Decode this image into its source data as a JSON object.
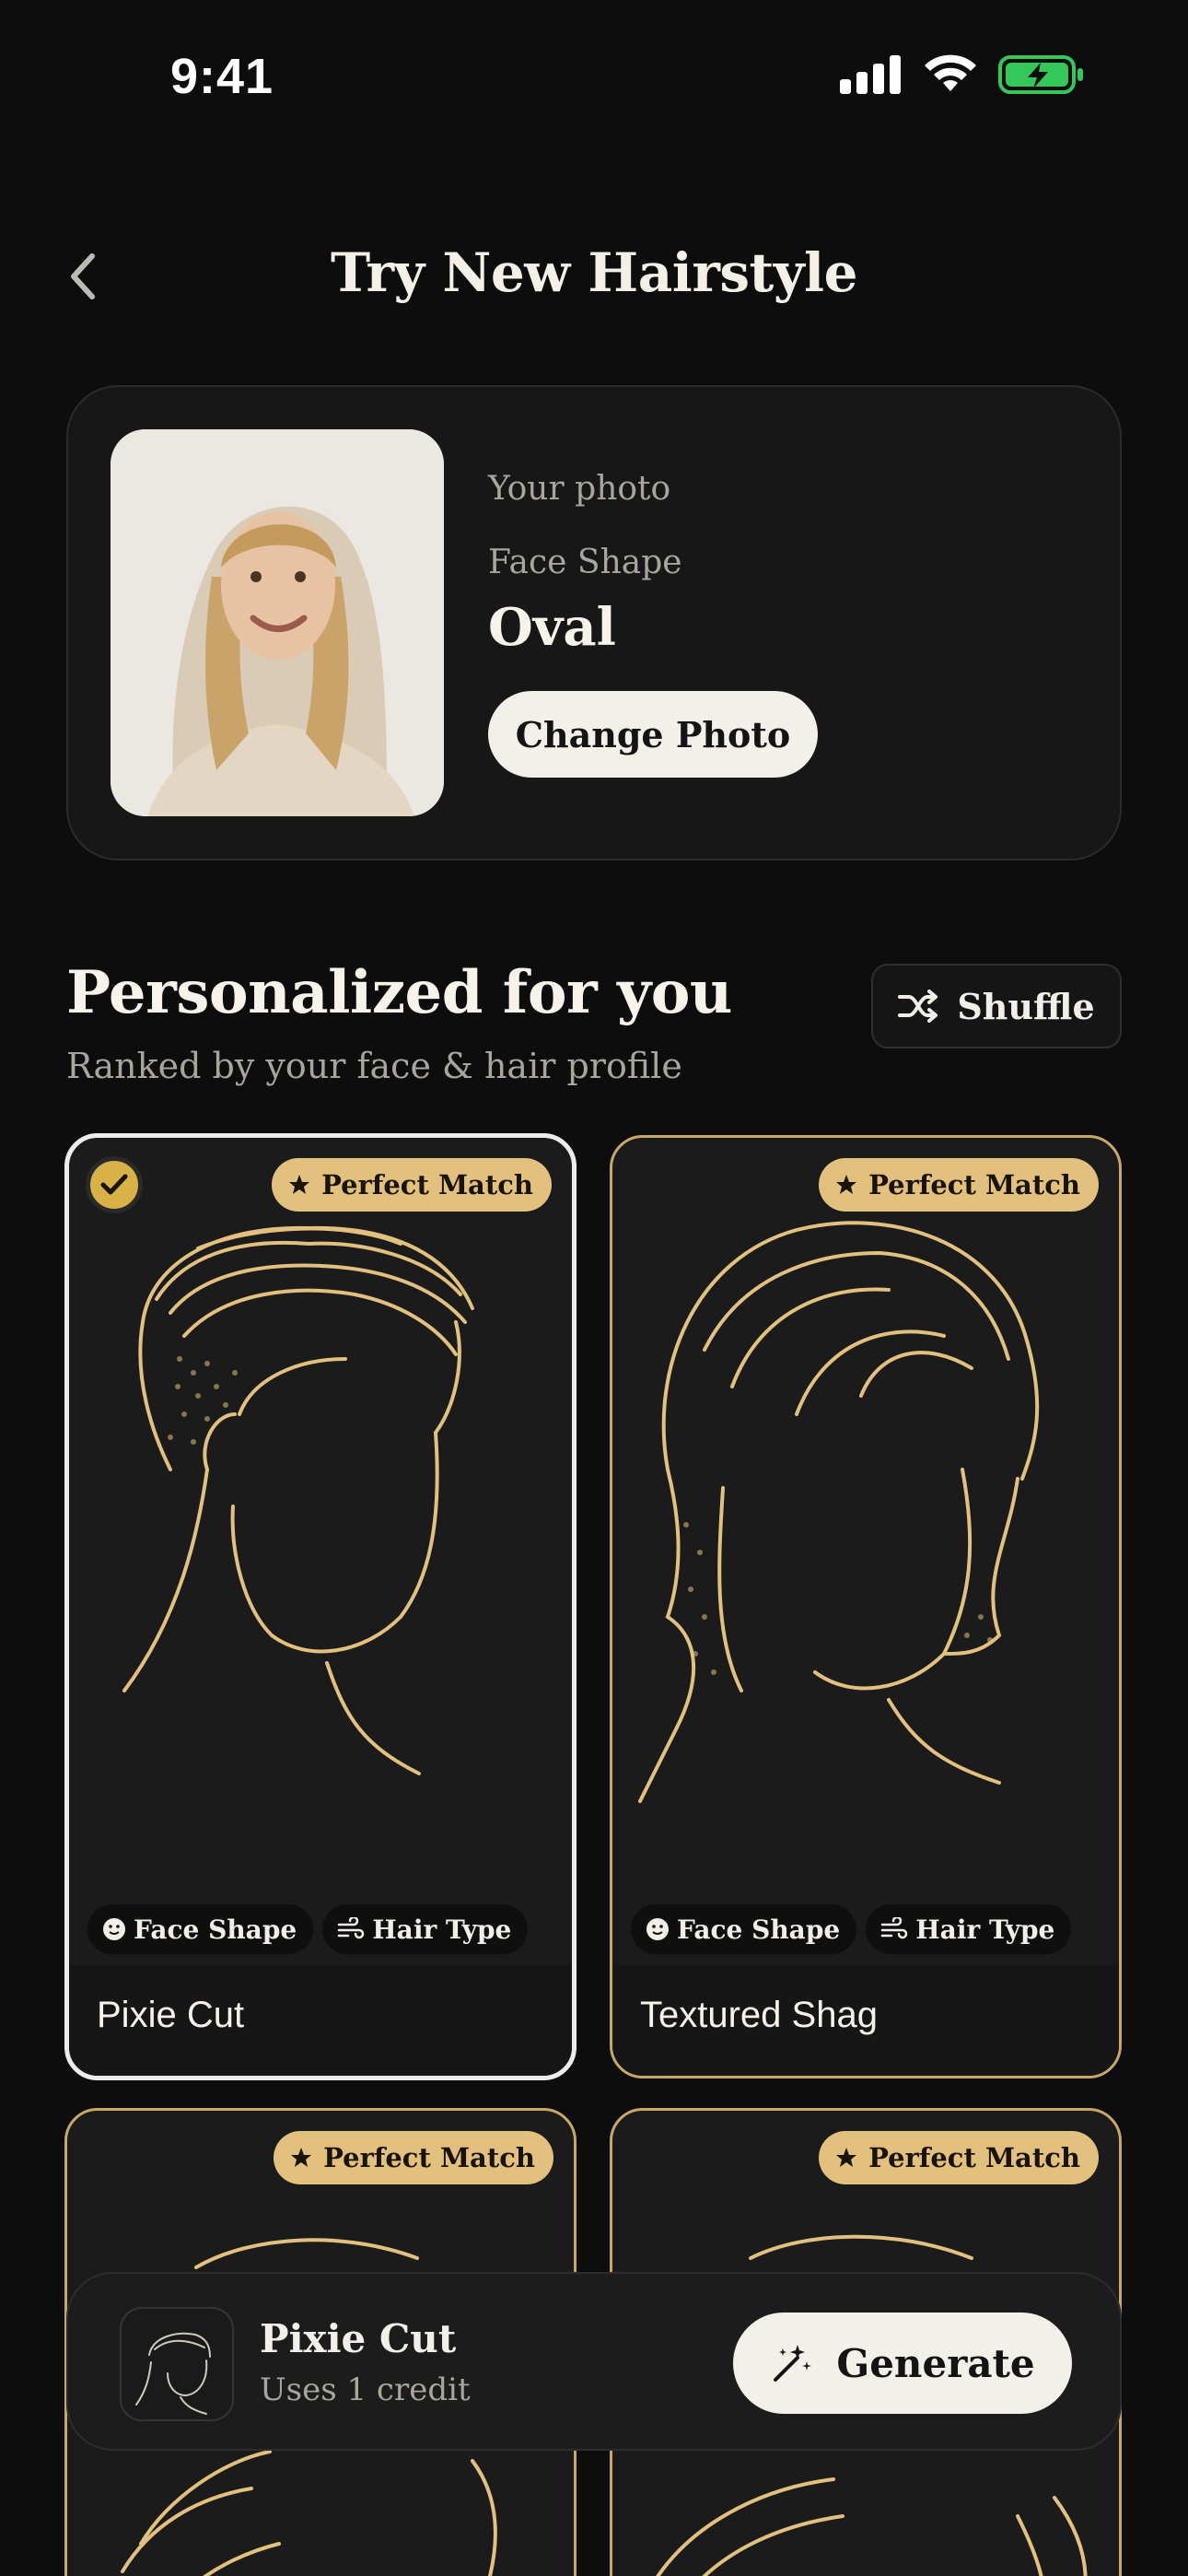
{
  "status_bar": {
    "time": "9:41"
  },
  "header": {
    "title": "Try New Hairstyle"
  },
  "photo_card": {
    "photo_label": "Your photo",
    "face_shape_label": "Face Shape",
    "face_shape_value": "Oval",
    "change_photo_label": "Change Photo"
  },
  "section": {
    "title": "Personalized for you",
    "subtitle": "Ranked by your face & hair profile",
    "shuffle_label": "Shuffle"
  },
  "styles": [
    {
      "name": "Pixie Cut",
      "badge": "Perfect Match",
      "chips": [
        "Face Shape",
        "Hair Type"
      ],
      "selected": true
    },
    {
      "name": "Textured Shag",
      "badge": "Perfect Match",
      "chips": [
        "Face Shape",
        "Hair Type"
      ],
      "selected": false
    },
    {
      "name": "",
      "badge": "Perfect Match",
      "chips": [],
      "selected": false
    },
    {
      "name": "",
      "badge": "Perfect Match",
      "chips": [],
      "selected": false
    }
  ],
  "generate_bar": {
    "style_name": "Pixie Cut",
    "credit_text": "Uses 1 credit",
    "generate_label": "Generate"
  },
  "colors": {
    "background": "#0d0d0d",
    "gold": "#e2c07d",
    "card": "#1b1b1b",
    "button": "#f3f0e9",
    "battery": "#34c759"
  },
  "icons": [
    "signal-icon",
    "wifi-icon",
    "battery-icon",
    "back-chevron-icon",
    "shuffle-icon",
    "star-icon",
    "check-icon",
    "face-icon",
    "wind-icon",
    "sparkle-wand-icon"
  ]
}
